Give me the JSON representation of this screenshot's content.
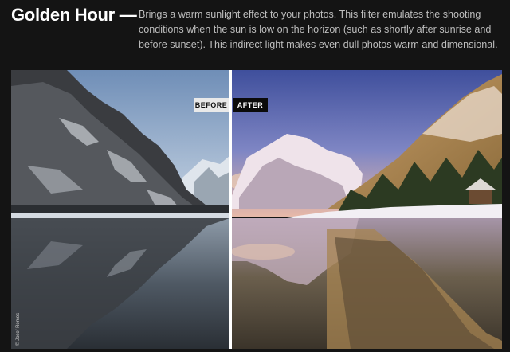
{
  "header": {
    "title": "Golden Hour —",
    "description": "Brings a warm sunlight effect to your photos. This filter emulates the shooting conditions when the sun is low on the horizon (such as shortly after sunrise and before sunset). This indirect light makes even dull photos warm and dimensional."
  },
  "comparison": {
    "before_label": "BEFORE",
    "after_label": "AFTER",
    "photo_credit": "© Josef Remos"
  },
  "colors": {
    "background": "#141414",
    "title": "#ffffff",
    "description": "#bdbdbd",
    "before_badge": "#e9e9e9",
    "after_badge": "#0b0b0b"
  }
}
